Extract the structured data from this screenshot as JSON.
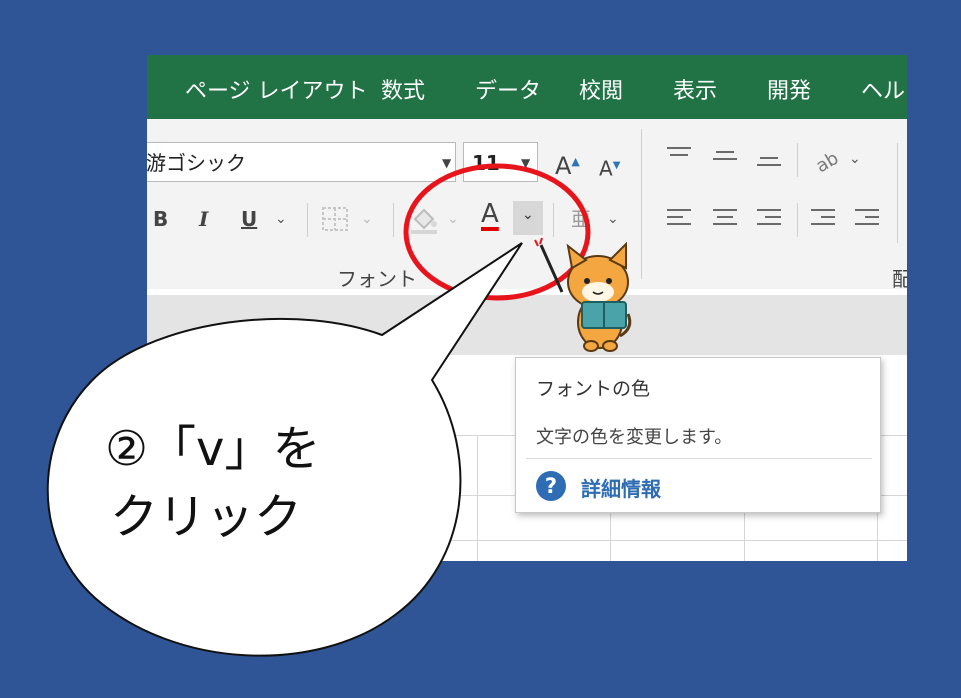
{
  "tabs": [
    {
      "label": "ページ レイアウト"
    },
    {
      "label": "数式"
    },
    {
      "label": "データ"
    },
    {
      "label": "校閲"
    },
    {
      "label": "表示"
    },
    {
      "label": "開発"
    },
    {
      "label": "ヘルプ"
    }
  ],
  "font_group": {
    "font_name": "游ゴシック",
    "font_size": "11",
    "bold": "B",
    "italic": "I",
    "underline": "U",
    "font_color_letter": "A",
    "grow_letter": "A",
    "shrink_letter": "A",
    "group_label": "フォント",
    "font_color_swatch": "#e00000"
  },
  "alignment_group": {
    "group_label": "配置"
  },
  "tooltip": {
    "title": "フォントの色",
    "description": "文字の色を変更します。",
    "help_link": "詳細情報",
    "help_icon": "?"
  },
  "callout": {
    "line1": "②「v」を",
    "line2": "クリック"
  },
  "colors": {
    "background": "#2f5597",
    "tab_bar": "#217346",
    "highlight_circle": "#e8141c",
    "help_accent": "#2e6db4"
  }
}
